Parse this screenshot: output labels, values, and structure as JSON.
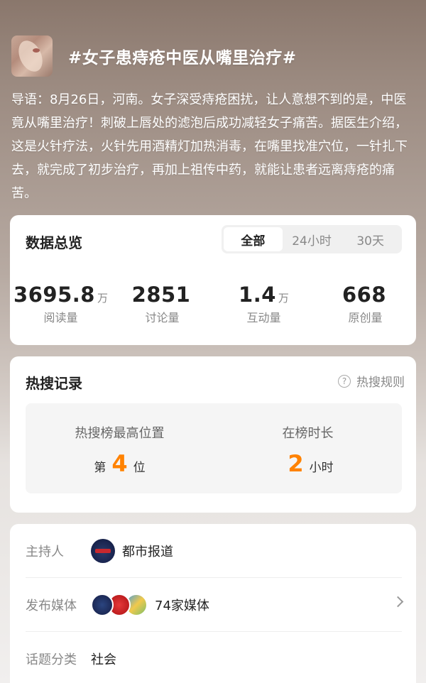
{
  "topic": {
    "title": "#女子患痔疮中医从嘴里治疗#",
    "intro": "导语：8月26日，河南。女子深受痔疮困扰，让人意想不到的是，中医竟从嘴里治疗！刺破上唇处的滤泡后成功减轻女子痛苦。据医生介绍，这是火针疗法，火针先用酒精灯加热消毒，在嘴里找准穴位，一针扎下去，就完成了初步治疗，再加上祖传中药，就能让患者远离痔疮的痛苦。"
  },
  "overview": {
    "title": "数据总览",
    "tabs": [
      "全部",
      "24小时",
      "30天"
    ],
    "active_tab": "全部",
    "stats": [
      {
        "value": "3695.8",
        "unit": "万",
        "label": "阅读量"
      },
      {
        "value": "2851",
        "unit": "",
        "label": "讨论量"
      },
      {
        "value": "1.4",
        "unit": "万",
        "label": "互动量"
      },
      {
        "value": "668",
        "unit": "",
        "label": "原创量"
      }
    ]
  },
  "hot_search": {
    "title": "热搜记录",
    "rule_label": "热搜规则",
    "peak_label": "热搜榜最高位置",
    "peak_prefix": "第",
    "peak_value": "4",
    "peak_suffix": "位",
    "duration_label": "在榜时长",
    "duration_value": "2",
    "duration_unit": "小时"
  },
  "info": {
    "host_label": "主持人",
    "host_name": "都市报道",
    "media_label": "发布媒体",
    "media_count": "74家媒体",
    "category_label": "话题分类",
    "category_value": "社会"
  },
  "colors": {
    "accent_orange": "#ff8200"
  }
}
